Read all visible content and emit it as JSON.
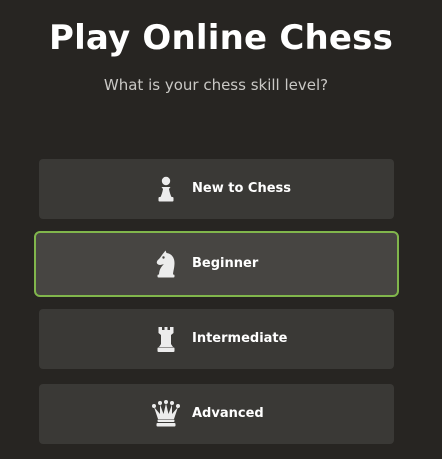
{
  "header": {
    "title": "Play Online Chess",
    "subtitle": "What is your chess skill level?"
  },
  "options": [
    {
      "label": "New to Chess",
      "icon": "pawn-icon",
      "selected": false
    },
    {
      "label": "Beginner",
      "icon": "knight-icon",
      "selected": true
    },
    {
      "label": "Intermediate",
      "icon": "rook-icon",
      "selected": false
    },
    {
      "label": "Advanced",
      "icon": "queen-icon",
      "selected": false
    }
  ],
  "colors": {
    "background": "#272522",
    "option_background": "#3a3936",
    "selected_background": "#474542",
    "selected_border": "#81b64c",
    "icon": "#ececec"
  }
}
